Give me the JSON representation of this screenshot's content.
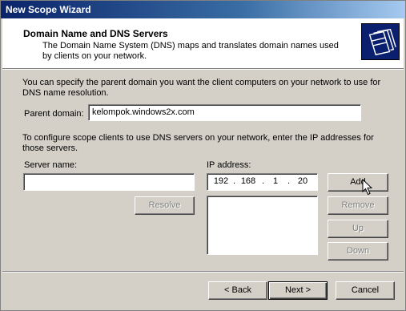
{
  "window": {
    "title": "New Scope Wizard"
  },
  "header": {
    "title": "Domain Name and DNS Servers",
    "subtitle": "The Domain Name System (DNS) maps and translates domain names used by clients on your network."
  },
  "intro_text": "You can specify the parent domain you want the client computers on your network to use for DNS name resolution.",
  "parent_domain": {
    "label": "Parent domain:",
    "value": "kelompok.windows2x.com"
  },
  "dns_text": "To configure scope clients to use DNS servers on your network, enter the IP addresses for those servers.",
  "server_name": {
    "label": "Server name:",
    "value": ""
  },
  "ip_address": {
    "label": "IP address:",
    "octets": [
      "192",
      "168",
      "1",
      "20"
    ]
  },
  "buttons": {
    "add": "Add",
    "resolve": "Resolve",
    "remove": "Remove",
    "up": "Up",
    "down": "Down",
    "back": "< Back",
    "next": "Next >",
    "cancel": "Cancel"
  },
  "icons": {
    "wizard_icon": "folder-documents-icon",
    "cursor": "mouse-pointer-icon"
  },
  "colors": {
    "title_bar_start": "#0a246a",
    "dialog_background": "#d4d0c8",
    "disabled_text": "#808080"
  }
}
